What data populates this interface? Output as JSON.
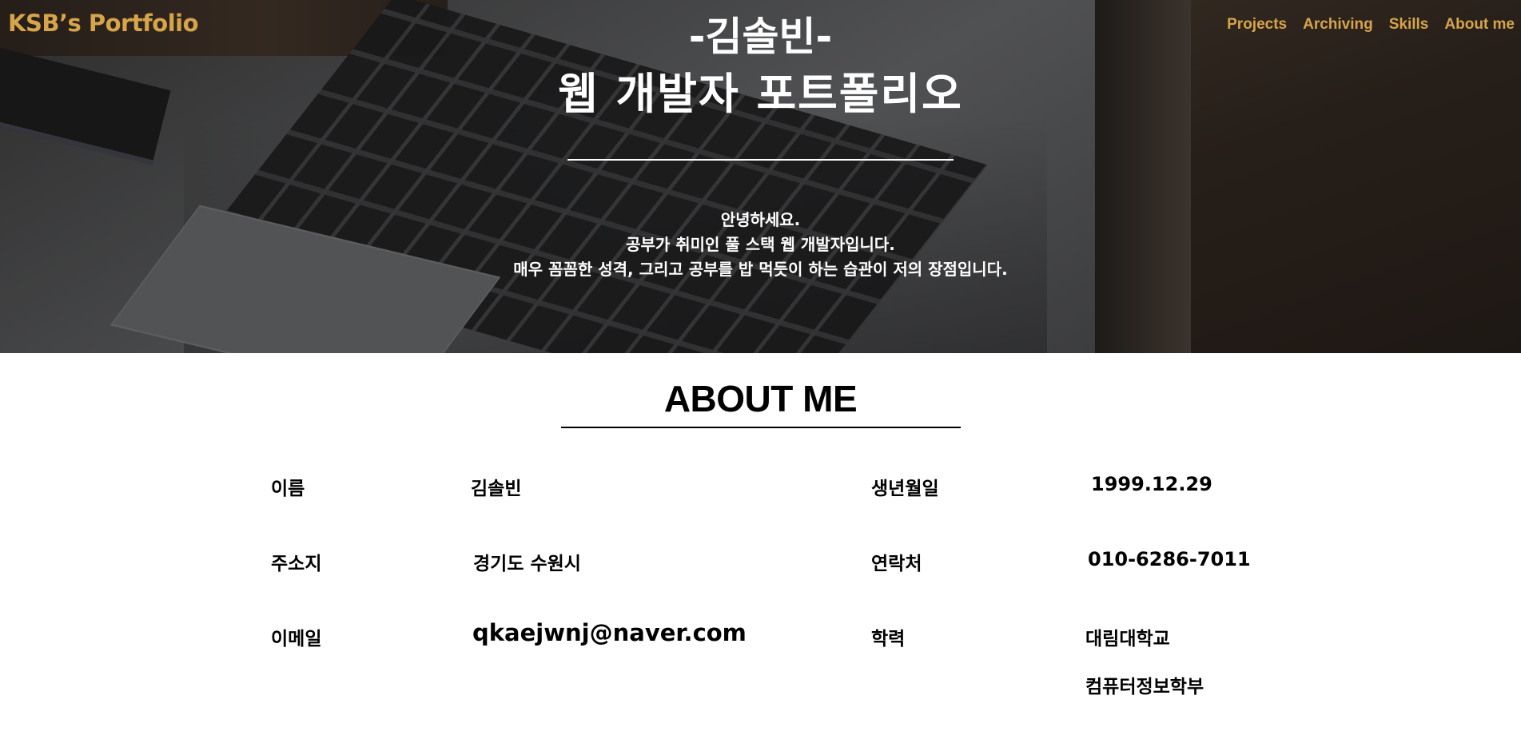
{
  "header": {
    "logo": "KSB’s Portfolio",
    "nav": [
      "Projects",
      "Archiving",
      "Skills",
      "About me"
    ]
  },
  "hero": {
    "title_line1": "-김솔빈-",
    "title_line2": "웹 개발자 포트폴리오",
    "intro": [
      "안녕하세요.",
      "공부가 취미인 풀 스택 웹 개발자입니다.",
      "매우 꼼꼼한 성격, 그리고 공부를 밥 먹듯이 하는 습관이 저의 장점입니다."
    ]
  },
  "about": {
    "title": "ABOUT ME",
    "fields": {
      "name_label": "이름",
      "name_value": "김솔빈",
      "birth_label": "생년월일",
      "birth_value": "1999.12.29",
      "address_label": "주소지",
      "address_value": "경기도 수원시",
      "contact_label": "연락처",
      "contact_value": "010-6286-7011",
      "email_label": "이메일",
      "email_value": "qkaejwnj@naver.com",
      "education_label": "학력",
      "education_value_1": "대림대학교",
      "education_value_2": "컴퓨터정보학부"
    }
  },
  "colors": {
    "accent": "#d6a44a",
    "hero_text": "#ffffff",
    "body_text": "#000000"
  }
}
